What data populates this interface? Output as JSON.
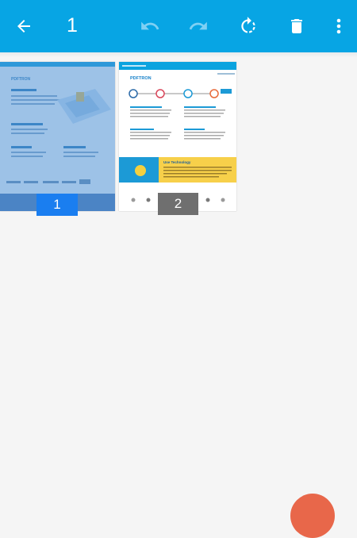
{
  "toolbar": {
    "selected_count": "1",
    "icons": [
      "back-arrow-icon",
      "undo-icon",
      "redo-icon",
      "rotate-icon",
      "delete-icon",
      "more-vert-icon"
    ],
    "color": "#07a5e4"
  },
  "pages": [
    {
      "number": "1",
      "selected": true
    },
    {
      "number": "2",
      "selected": false
    }
  ],
  "thumb_text": {
    "brand": "PDFTRON",
    "section": "Use Technology"
  },
  "colors": {
    "selection_overlay": "#4d8fd4",
    "selected_badge": "#1a7ef0",
    "unselected_badge": "#6f6f6f",
    "fab": "#e8674a"
  }
}
